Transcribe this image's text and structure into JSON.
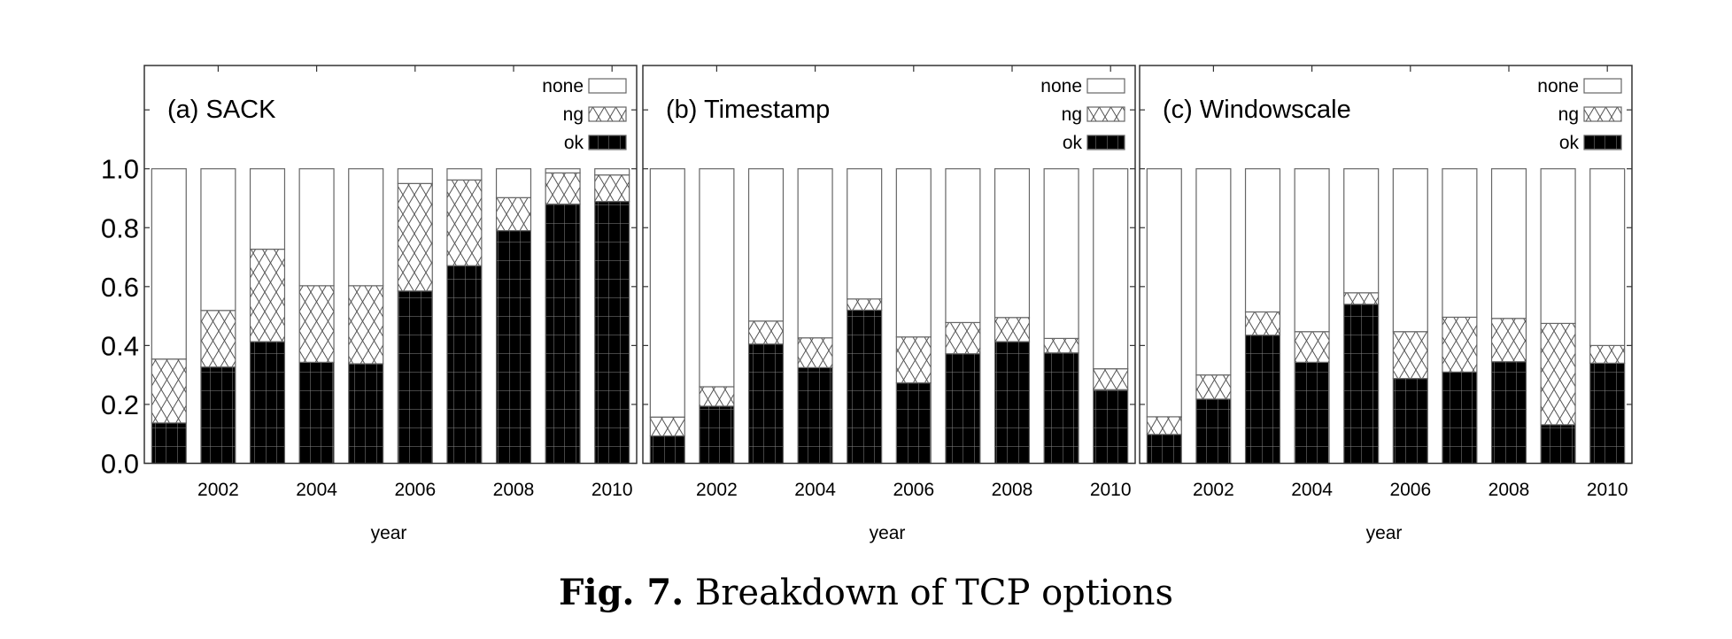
{
  "caption": {
    "label": "Fig. 7.",
    "text": "Breakdown of TCP options"
  },
  "chart_data": {
    "type": "bar",
    "stacked": true,
    "normalized": true,
    "categories": [
      2001,
      2002,
      2003,
      2004,
      2005,
      2006,
      2007,
      2008,
      2009,
      2010
    ],
    "x_tick_labels": [
      "2002",
      "2004",
      "2006",
      "2008",
      "2010"
    ],
    "xlabel": "year",
    "ylabel": "",
    "ylim": [
      0,
      1.0
    ],
    "y_tick_labels": [
      "0.0",
      "0.2",
      "0.4",
      "0.6",
      "0.8",
      "1.0"
    ],
    "grid": false,
    "legend": {
      "placement": "top-right",
      "entries": [
        "none",
        "ng",
        "ok"
      ]
    },
    "panels": [
      {
        "title": "(a) SACK",
        "series": [
          {
            "name": "ok",
            "values": [
              0.137,
              0.327,
              0.413,
              0.343,
              0.338,
              0.585,
              0.671,
              0.79,
              0.88,
              0.889
            ]
          },
          {
            "name": "ng",
            "values": [
              0.217,
              0.192,
              0.314,
              0.26,
              0.265,
              0.365,
              0.291,
              0.112,
              0.106,
              0.09
            ]
          },
          {
            "name": "none",
            "values": [
              0.646,
              0.481,
              0.273,
              0.397,
              0.397,
              0.05,
              0.038,
              0.098,
              0.014,
              0.021
            ]
          }
        ]
      },
      {
        "title": "(b) Timestamp",
        "series": [
          {
            "name": "ok",
            "values": [
              0.093,
              0.194,
              0.405,
              0.325,
              0.52,
              0.273,
              0.372,
              0.413,
              0.375,
              0.25
            ]
          },
          {
            "name": "ng",
            "values": [
              0.064,
              0.066,
              0.078,
              0.101,
              0.038,
              0.156,
              0.106,
              0.082,
              0.049,
              0.071
            ]
          },
          {
            "name": "none",
            "values": [
              0.843,
              0.74,
              0.517,
              0.574,
              0.442,
              0.571,
              0.522,
              0.505,
              0.576,
              0.679
            ]
          }
        ]
      },
      {
        "title": "(c) Windowscale",
        "series": [
          {
            "name": "ok",
            "values": [
              0.098,
              0.218,
              0.435,
              0.343,
              0.54,
              0.288,
              0.31,
              0.345,
              0.131,
              0.34
            ]
          },
          {
            "name": "ng",
            "values": [
              0.06,
              0.082,
              0.079,
              0.104,
              0.039,
              0.159,
              0.186,
              0.147,
              0.344,
              0.06
            ]
          },
          {
            "name": "none",
            "values": [
              0.842,
              0.7,
              0.486,
              0.553,
              0.421,
              0.553,
              0.504,
              0.508,
              0.525,
              0.6
            ]
          }
        ]
      }
    ]
  }
}
